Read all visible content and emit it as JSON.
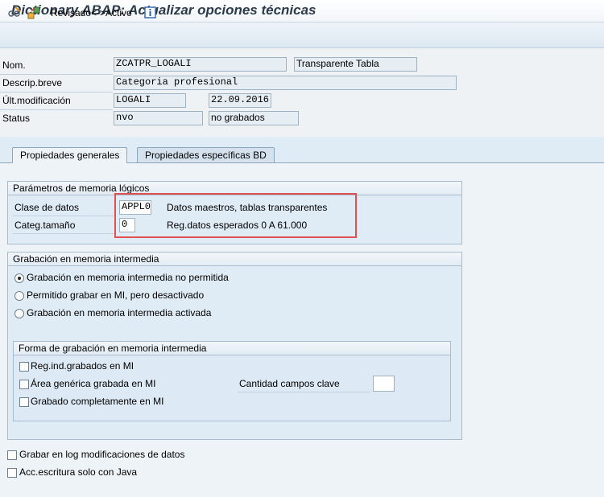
{
  "window": {
    "title": "Dictionary ABAP: Actualizar opciones técnicas"
  },
  "toolbar": {
    "toggle_label": "Revisado<->Activo"
  },
  "header": {
    "nom_label": "Nom.",
    "nom_value": "ZCATPR_LOGALI",
    "table_type": "Transparente Tabla",
    "descrip_label": "Descrip.breve",
    "descrip_value": "Categoria profesional",
    "ultmod_label": "Últ.modificación",
    "ultmod_user": "LOGALI",
    "ultmod_date": "22.09.2016",
    "status_label": "Status",
    "status_value": "nvo",
    "status_text": "no grabados"
  },
  "tabs": [
    {
      "label": "Propiedades generales",
      "active": true
    },
    {
      "label": "Propiedades específicas BD",
      "active": false
    }
  ],
  "params_group": {
    "title": "Parámetros de memoria lógicos",
    "clase_label": "Clase de datos",
    "clase_value": "APPL0",
    "clase_desc": "Datos maestros, tablas transparentes",
    "categ_label": "Categ.tamaño",
    "categ_value": "0",
    "categ_desc": "Reg.datos esperados 0 A 61.000"
  },
  "buffer_group": {
    "title": "Grabación en memoria intermedia",
    "options": [
      {
        "label": "Grabación en memoria intermedia no permitida",
        "selected": true
      },
      {
        "label": "Permitido grabar en MI, pero desactivado",
        "selected": false
      },
      {
        "label": "Grabación en memoria intermedia activada",
        "selected": false
      }
    ]
  },
  "buffer_type_group": {
    "title": "Forma de grabación en memoria intermedia",
    "single_label": "Reg.ind.grabados en MI",
    "generic_label": "Área genérica grabada en MI",
    "full_label": "Grabado completamente en MI",
    "key_fields_label": "Cantidad campos clave",
    "key_fields_value": ""
  },
  "bottom": {
    "log_label": "Grabar en log modificaciones de datos",
    "java_label": "Acc.escritura solo con Java"
  },
  "colors": {
    "highlight_border": "#e05050",
    "background": "#dfebf5"
  }
}
